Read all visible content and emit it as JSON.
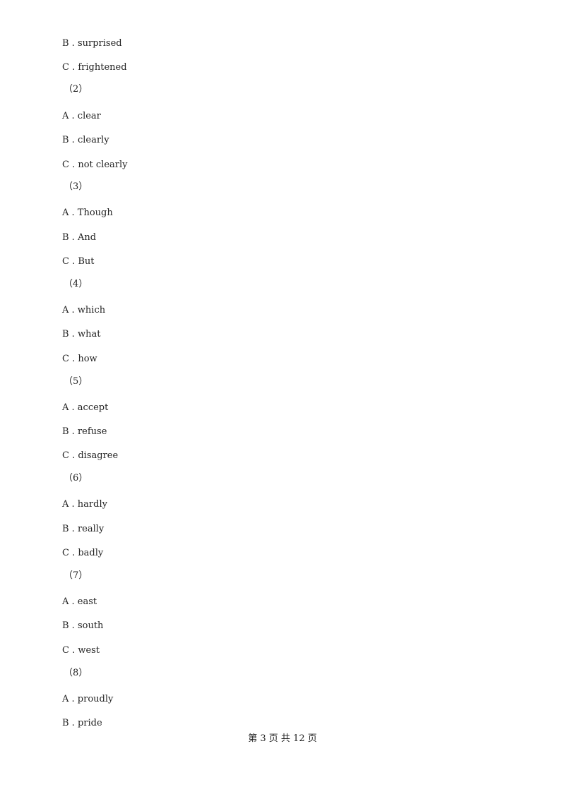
{
  "lines": [
    {
      "type": "option",
      "text": "B . surprised"
    },
    {
      "type": "option",
      "text": "C . frightened"
    },
    {
      "type": "number",
      "text": "（2）"
    },
    {
      "type": "option",
      "text": "A . clear"
    },
    {
      "type": "option",
      "text": "B . clearly"
    },
    {
      "type": "option",
      "text": "C . not clearly"
    },
    {
      "type": "number",
      "text": "（3）"
    },
    {
      "type": "option",
      "text": "A . Though"
    },
    {
      "type": "option",
      "text": "B . And"
    },
    {
      "type": "option",
      "text": "C . But"
    },
    {
      "type": "number",
      "text": "（4）"
    },
    {
      "type": "option",
      "text": "A . which"
    },
    {
      "type": "option",
      "text": "B . what"
    },
    {
      "type": "option",
      "text": "C . how"
    },
    {
      "type": "number",
      "text": "（5）"
    },
    {
      "type": "option",
      "text": "A . accept"
    },
    {
      "type": "option",
      "text": "B . refuse"
    },
    {
      "type": "option",
      "text": "C . disagree"
    },
    {
      "type": "number",
      "text": "（6）"
    },
    {
      "type": "option",
      "text": "A . hardly"
    },
    {
      "type": "option",
      "text": "B . really"
    },
    {
      "type": "option",
      "text": "C . badly"
    },
    {
      "type": "number",
      "text": "（7）"
    },
    {
      "type": "option",
      "text": "A . east"
    },
    {
      "type": "option",
      "text": "B . south"
    },
    {
      "type": "option",
      "text": "C . west"
    },
    {
      "type": "number",
      "text": "（8）"
    },
    {
      "type": "option",
      "text": "A . proudly"
    },
    {
      "type": "option",
      "text": "B . pride"
    }
  ],
  "footer": "第 3 页 共 12 页"
}
